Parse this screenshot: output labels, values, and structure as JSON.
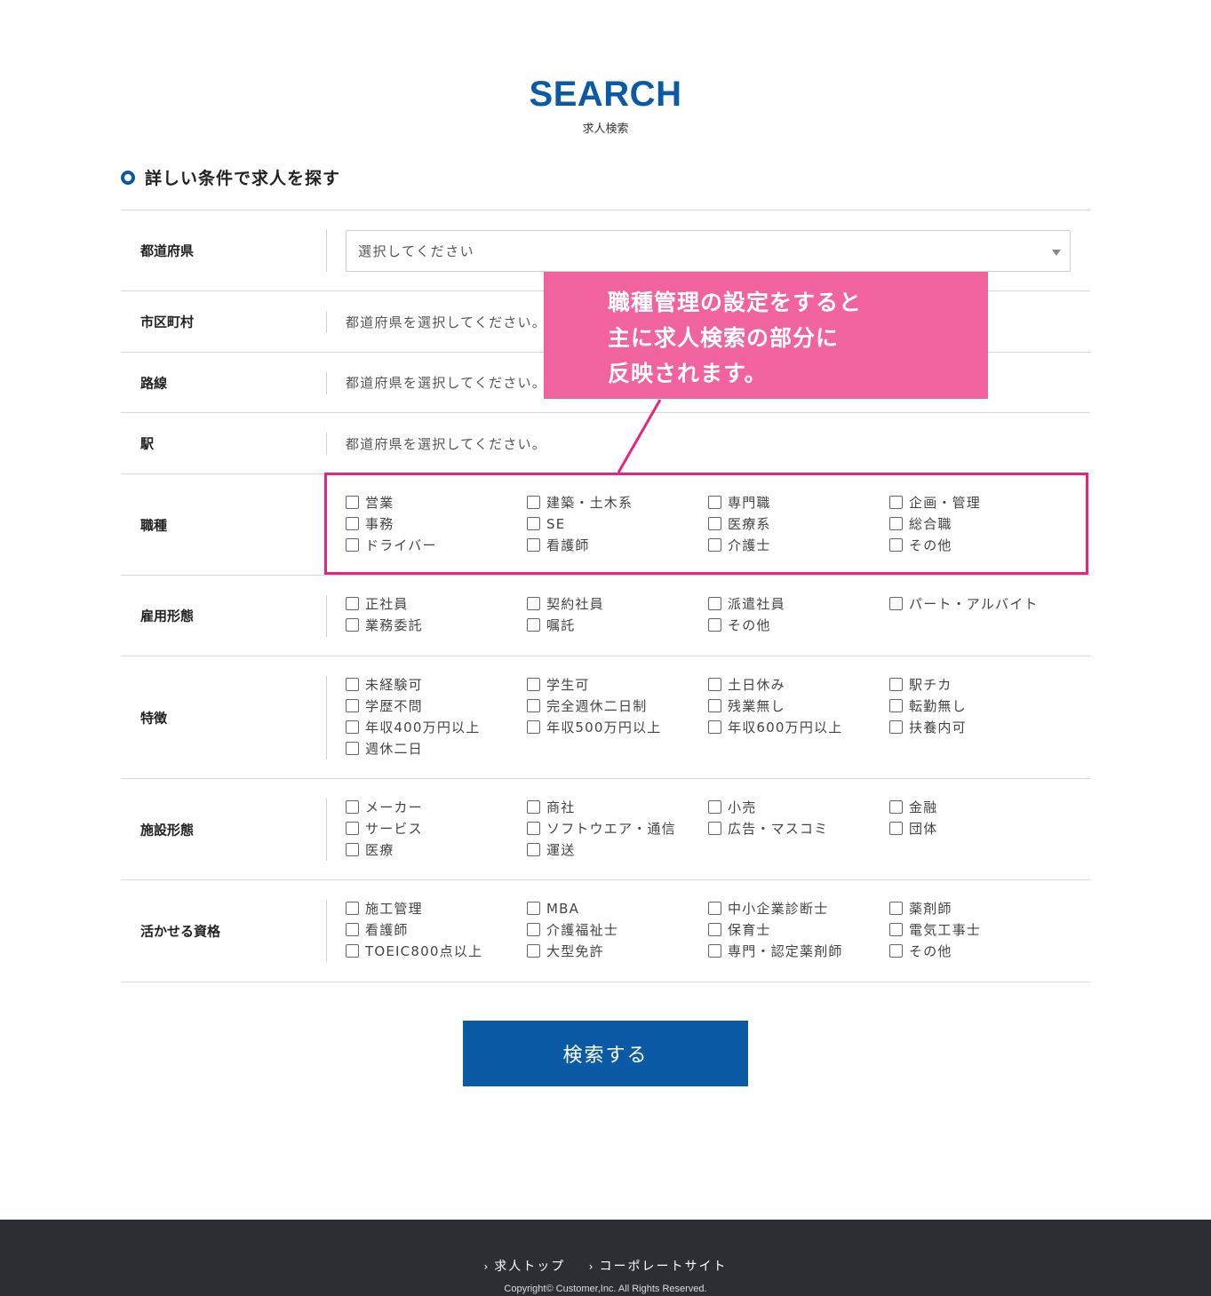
{
  "header": {
    "title_en": "SEARCH",
    "title_ja": "求人検索"
  },
  "section": {
    "title": "詳しい条件で求人を探す"
  },
  "form": {
    "prefecture": {
      "label": "都道府県",
      "placeholder": "選択してください"
    },
    "city": {
      "label": "市区町村",
      "note": "都道府県を選択してください。"
    },
    "route": {
      "label": "路線",
      "note": "都道府県を選択してください。"
    },
    "station": {
      "label": "駅",
      "note": "都道府県を選択してください。"
    },
    "job_type": {
      "label": "職種",
      "options": [
        "営業",
        "建築・土木系",
        "専門職",
        "企画・管理",
        "事務",
        "SE",
        "医療系",
        "総合職",
        "ドライバー",
        "看護師",
        "介護士",
        "その他"
      ]
    },
    "employment": {
      "label": "雇用形態",
      "options": [
        "正社員",
        "契約社員",
        "派遣社員",
        "パート・アルバイト",
        "業務委託",
        "嘱託",
        "その他"
      ]
    },
    "features": {
      "label": "特徴",
      "options": [
        "未経験可",
        "学生可",
        "土日休み",
        "駅チカ",
        "学歴不問",
        "完全週休二日制",
        "残業無し",
        "転勤無し",
        "年収400万円以上",
        "年収500万円以上",
        "年収600万円以上",
        "扶養内可",
        "週休二日"
      ]
    },
    "facility": {
      "label": "施設形態",
      "options": [
        "メーカー",
        "商社",
        "小売",
        "金融",
        "サービス",
        "ソフトウエア・通信",
        "広告・マスコミ",
        "団体",
        "医療",
        "運送"
      ]
    },
    "qualification": {
      "label": "活かせる資格",
      "options": [
        "施工管理",
        "MBA",
        "中小企業診断士",
        "薬剤師",
        "看護師",
        "介護福祉士",
        "保育士",
        "電気工事士",
        "TOEIC800点以上",
        "大型免許",
        "専門・認定薬剤師",
        "その他"
      ]
    }
  },
  "callout": {
    "lines": [
      "職種管理の設定をすると",
      "主に求人検索の部分に",
      "反映されます。"
    ]
  },
  "search_button": {
    "label": "検索する"
  },
  "footer": {
    "link_top": "求人トップ",
    "link_corporate": "コーポレートサイト",
    "copyright": "Copyright© Customer,Inc. All Rights Reserved."
  },
  "colors": {
    "accent": "#0b5aa6",
    "highlight": "#e8247f",
    "callout_bg": "#f0639f",
    "footer_bg": "#2b2e33"
  }
}
